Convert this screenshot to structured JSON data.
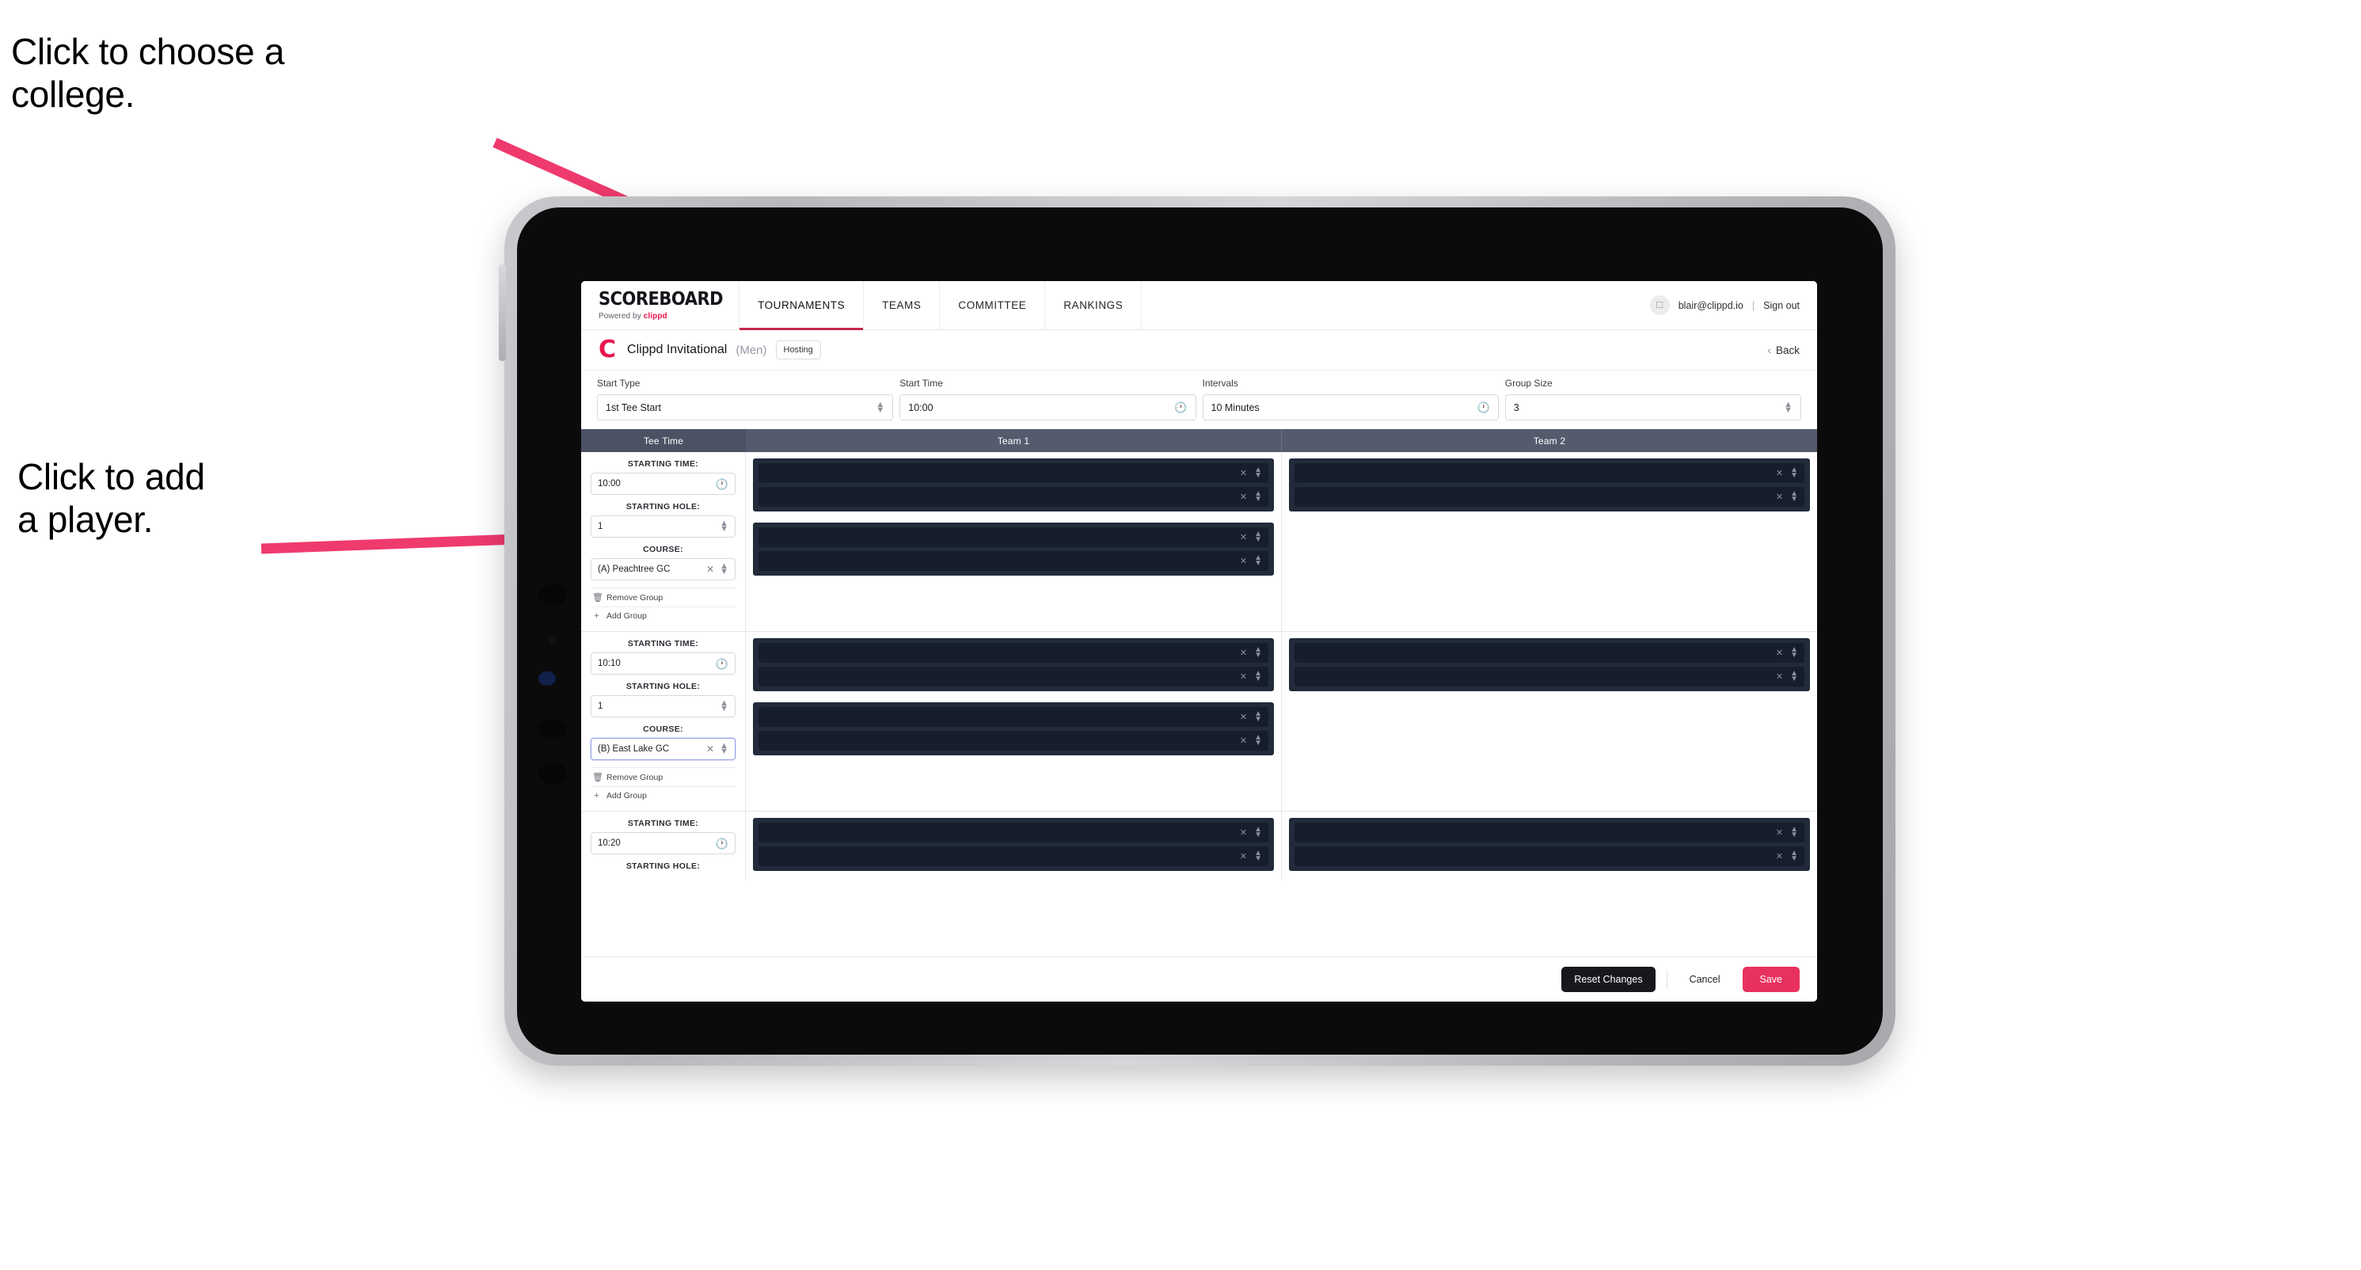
{
  "annotations": [
    {
      "id": "college",
      "text": "Click to choose a\ncollege."
    },
    {
      "id": "player",
      "text": "Click to add\na player."
    }
  ],
  "annotation_color": "#ef3a6e",
  "navbar": {
    "brand_title": "SCOREBOARD",
    "brand_sub_prefix": "Powered by ",
    "brand_sub_brand": "clippd",
    "tabs": [
      {
        "label": "TOURNAMENTS",
        "active": true
      },
      {
        "label": "TEAMS",
        "active": false
      },
      {
        "label": "COMMITTEE",
        "active": false
      },
      {
        "label": "RANKINGS",
        "active": false
      }
    ],
    "avatar_icon": "user-avatar-icon",
    "email": "blair@clippd.io",
    "separator": "|",
    "sign_out": "Sign out"
  },
  "titlebar": {
    "logo_letter": "C",
    "tournament_name": "Clippd Invitational",
    "gender": "(Men)",
    "status_chip": "Hosting",
    "back_chevron": "‹",
    "back_label": "Back"
  },
  "controls": [
    {
      "label": "Start Type",
      "value": "1st Tee Start",
      "icon": "stepper-icon"
    },
    {
      "label": "Start Time",
      "value": "10:00",
      "icon": "clock-icon"
    },
    {
      "label": "Intervals",
      "value": "10 Minutes",
      "icon": "clock-icon"
    },
    {
      "label": "Group Size",
      "value": "3",
      "icon": "stepper-icon"
    }
  ],
  "table": {
    "headers": {
      "tee_time": "Tee Time",
      "team1": "Team 1",
      "team2": "Team 2"
    },
    "field_labels": {
      "starting_time": "STARTING TIME:",
      "starting_hole": "STARTING HOLE:",
      "course": "COURSE:"
    },
    "actions": {
      "remove_group": "Remove Group",
      "add_group": "Add Group"
    },
    "groups": [
      {
        "starting_time": "10:00",
        "starting_hole": "1",
        "course": "(A) Peachtree GC",
        "course_focused": false,
        "team1_panels": [
          2,
          2
        ],
        "team2_panels": [
          2
        ]
      },
      {
        "starting_time": "10:10",
        "starting_hole": "1",
        "course": "(B) East Lake GC",
        "course_focused": true,
        "team1_panels": [
          2,
          2
        ],
        "team2_panels": [
          2
        ]
      },
      {
        "starting_time": "10:20",
        "starting_hole": "",
        "course": "",
        "course_focused": false,
        "team1_panels": [
          2
        ],
        "team2_panels": [
          2
        ]
      }
    ]
  },
  "footer": {
    "reset": "Reset Changes",
    "cancel": "Cancel",
    "save": "Save"
  },
  "colors": {
    "accent_pink": "#e8315e",
    "brand_red": "#e8174c",
    "header_slate": "#545b6d",
    "panel_dark": "#222b3a",
    "row_dark": "#161d2b"
  }
}
